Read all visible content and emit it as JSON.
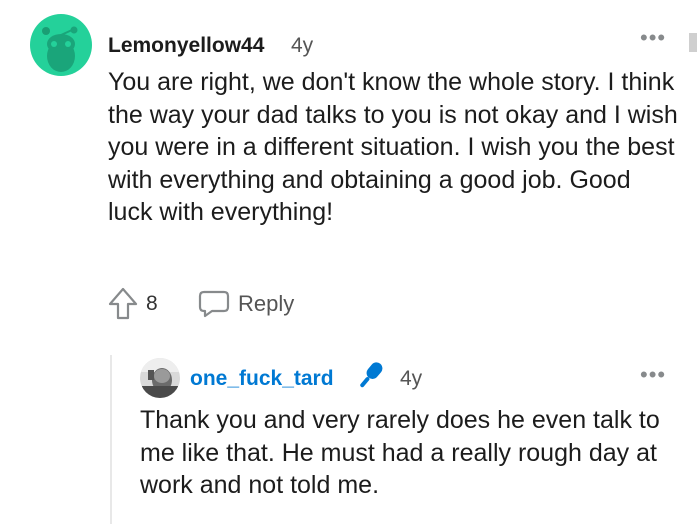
{
  "comment": {
    "username": "Lemonyellow44",
    "age": "4y",
    "more_label": "•••",
    "body": "You are right, we don't know the whole story. I think the way your dad talks to you is not okay and I wish you were in a different situation. I wish you the best with everything and obtaining a good job. Good luck with everything!",
    "avatar_icon": "snoo-avatar-icon",
    "avatar_color": "#24d19a",
    "votes": "8",
    "upvote_icon": "upvote-arrow-icon",
    "reply_label": "Reply",
    "reply_icon": "speech-bubble-icon"
  },
  "reply": {
    "username": "one_fuck_tard",
    "username_color": "#0079d3",
    "badge_icon": "microphone-icon",
    "age": "4y",
    "more_label": "•••",
    "body": "Thank you and very rarely does he even talk to me like that. He must had a really rough day at work and not told me.",
    "avatar_icon": "user-photo-avatar"
  }
}
